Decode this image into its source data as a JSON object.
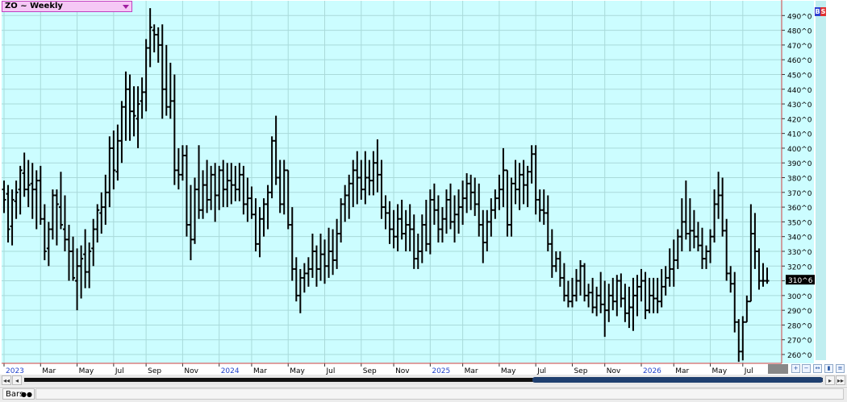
{
  "symbol_label": "ZO ~ Weekly",
  "bs_icons": {
    "buy": "B",
    "sell": "S"
  },
  "status": {
    "bars_label": "Bars"
  },
  "scroll": {
    "left_first": "◂◂",
    "left": "◂",
    "right": "▸",
    "right_last": "▸▸"
  },
  "toolbar_icons": [
    "zoom-in-icon",
    "zoom-out-icon",
    "scroll-icon",
    "chart-type-icon",
    "fit-icon",
    "settings-icon"
  ],
  "colors": {
    "background": "#ccfdff",
    "grid": "#a9dada",
    "bars": "#000000",
    "axis_line": "#d04040",
    "price_tag_bg": "#000000",
    "price_tag_text": "#ffffff",
    "month_text": "#000000",
    "year_text": "#2244cc"
  },
  "chart_data": {
    "type": "ohlc",
    "title": "ZO ~ Weekly",
    "ylim": [
      254,
      500
    ],
    "y_ticks": [
      260,
      270,
      280,
      290,
      300,
      310,
      320,
      330,
      340,
      350,
      360,
      370,
      380,
      390,
      400,
      410,
      420,
      430,
      440,
      450,
      460,
      470,
      480,
      490
    ],
    "y_tick_labels": [
      "260^0",
      "270^0",
      "280^0",
      "290^0",
      "300^0",
      "310^0",
      "320^0",
      "330^0",
      "340^0",
      "350^0",
      "360^0",
      "370^0",
      "380^0",
      "390^0",
      "400^0",
      "410^0",
      "420^0",
      "430^0",
      "440^0",
      "450^0",
      "460^0",
      "470^0",
      "480^0",
      "490^0"
    ],
    "last_price_label": "310^6",
    "last_price": 310.75,
    "x_labels": [
      {
        "label": "2023",
        "bar": 0,
        "year": true
      },
      {
        "label": "Mar",
        "bar": 9,
        "year": false
      },
      {
        "label": "May",
        "bar": 18,
        "year": false
      },
      {
        "label": "Jul",
        "bar": 27,
        "year": false
      },
      {
        "label": "Sep",
        "bar": 35,
        "year": false
      },
      {
        "label": "Nov",
        "bar": 44,
        "year": false
      },
      {
        "label": "2024",
        "bar": 53,
        "year": true
      },
      {
        "label": "Mar",
        "bar": 61,
        "year": false
      },
      {
        "label": "May",
        "bar": 70,
        "year": false
      },
      {
        "label": "Jul",
        "bar": 79,
        "year": false
      },
      {
        "label": "Sep",
        "bar": 88,
        "year": false
      },
      {
        "label": "Nov",
        "bar": 96,
        "year": false
      },
      {
        "label": "2025",
        "bar": 105,
        "year": true
      },
      {
        "label": "Mar",
        "bar": 113,
        "year": false
      },
      {
        "label": "May",
        "bar": 122,
        "year": false
      },
      {
        "label": "Jul",
        "bar": 131,
        "year": false
      },
      {
        "label": "Sep",
        "bar": 140,
        "year": false
      },
      {
        "label": "Nov",
        "bar": 148,
        "year": false
      },
      {
        "label": "2026",
        "bar": 157,
        "year": true
      },
      {
        "label": "Mar",
        "bar": 165,
        "year": false
      },
      {
        "label": "May",
        "bar": 174,
        "year": false
      },
      {
        "label": "Jul",
        "bar": 182,
        "year": false
      }
    ],
    "bars": [
      [
        372,
        378,
        356,
        365
      ],
      [
        369,
        375,
        336,
        345
      ],
      [
        347,
        372,
        334,
        365
      ],
      [
        364,
        378,
        352,
        370
      ],
      [
        372,
        388,
        355,
        385
      ],
      [
        383,
        397,
        367,
        372
      ],
      [
        372,
        392,
        360,
        375
      ],
      [
        376,
        390,
        352,
        372
      ],
      [
        372,
        385,
        345,
        378
      ],
      [
        378,
        388,
        348,
        352
      ],
      [
        352,
        362,
        324,
        330
      ],
      [
        332,
        350,
        320,
        345
      ],
      [
        345,
        372,
        338,
        368
      ],
      [
        368,
        372,
        334,
        362
      ],
      [
        360,
        384,
        345,
        348
      ],
      [
        345,
        368,
        330,
        338
      ],
      [
        338,
        348,
        310,
        330
      ],
      [
        330,
        340,
        310,
        312
      ],
      [
        310,
        332,
        290,
        320
      ],
      [
        320,
        334,
        298,
        325
      ],
      [
        328,
        345,
        305,
        316
      ],
      [
        316,
        336,
        305,
        330
      ],
      [
        332,
        352,
        320,
        345
      ],
      [
        345,
        362,
        336,
        358
      ],
      [
        356,
        370,
        342,
        360
      ],
      [
        360,
        382,
        348,
        370
      ],
      [
        370,
        408,
        360,
        400
      ],
      [
        400,
        412,
        372,
        385
      ],
      [
        384,
        416,
        378,
        405
      ],
      [
        405,
        432,
        390,
        428
      ],
      [
        428,
        452,
        405,
        440
      ],
      [
        440,
        450,
        405,
        425
      ],
      [
        425,
        442,
        408,
        422
      ],
      [
        420,
        442,
        400,
        430
      ],
      [
        432,
        448,
        420,
        438
      ],
      [
        438,
        474,
        425,
        468
      ],
      [
        468,
        495,
        455,
        482
      ],
      [
        480,
        484,
        465,
        477
      ],
      [
        477,
        482,
        458,
        470
      ],
      [
        470,
        484,
        420,
        440
      ],
      [
        440,
        470,
        422,
        428
      ],
      [
        428,
        458,
        420,
        432
      ],
      [
        432,
        450,
        375,
        385
      ],
      [
        385,
        400,
        372,
        382
      ],
      [
        382,
        402,
        378,
        395
      ],
      [
        395,
        402,
        340,
        348
      ],
      [
        348,
        375,
        324,
        338
      ],
      [
        338,
        380,
        335,
        372
      ],
      [
        372,
        402,
        352,
        358
      ],
      [
        358,
        385,
        352,
        375
      ],
      [
        375,
        392,
        356,
        365
      ],
      [
        365,
        388,
        358,
        382
      ],
      [
        382,
        390,
        350,
        368
      ],
      [
        368,
        388,
        358,
        385
      ],
      [
        385,
        392,
        360,
        372
      ],
      [
        372,
        390,
        360,
        378
      ],
      [
        378,
        390,
        362,
        375
      ],
      [
        375,
        388,
        364,
        372
      ],
      [
        372,
        390,
        364,
        382
      ],
      [
        382,
        388,
        355,
        362
      ],
      [
        362,
        380,
        350,
        366
      ],
      [
        366,
        374,
        352,
        355
      ],
      [
        355,
        366,
        330,
        335
      ],
      [
        335,
        360,
        326,
        352
      ],
      [
        352,
        366,
        340,
        362
      ],
      [
        362,
        375,
        345,
        370
      ],
      [
        370,
        408,
        366,
        405
      ],
      [
        405,
        422,
        375,
        380
      ],
      [
        380,
        392,
        356,
        362
      ],
      [
        362,
        392,
        355,
        385
      ],
      [
        385,
        382,
        345,
        348
      ],
      [
        348,
        360,
        310,
        318
      ],
      [
        318,
        326,
        296,
        300
      ],
      [
        300,
        318,
        288,
        312
      ],
      [
        312,
        322,
        302,
        315
      ],
      [
        315,
        326,
        306,
        318
      ],
      [
        318,
        342,
        312,
        330
      ],
      [
        330,
        334,
        306,
        318
      ],
      [
        318,
        342,
        310,
        328
      ],
      [
        328,
        338,
        308,
        320
      ],
      [
        320,
        346,
        312,
        330
      ],
      [
        330,
        345,
        314,
        324
      ],
      [
        324,
        352,
        318,
        342
      ],
      [
        342,
        366,
        336,
        362
      ],
      [
        362,
        375,
        350,
        368
      ],
      [
        368,
        382,
        352,
        376
      ],
      [
        376,
        392,
        360,
        385
      ],
      [
        385,
        398,
        362,
        380
      ],
      [
        380,
        392,
        365,
        372
      ],
      [
        372,
        398,
        362,
        380
      ],
      [
        380,
        392,
        368,
        378
      ],
      [
        378,
        398,
        368,
        390
      ],
      [
        390,
        406,
        370,
        382
      ],
      [
        382,
        392,
        352,
        360
      ],
      [
        360,
        368,
        345,
        356
      ],
      [
        356,
        364,
        335,
        345
      ],
      [
        345,
        358,
        332,
        340
      ],
      [
        340,
        362,
        330,
        352
      ],
      [
        352,
        365,
        338,
        342
      ],
      [
        342,
        358,
        330,
        348
      ],
      [
        348,
        362,
        330,
        345
      ],
      [
        345,
        355,
        318,
        325
      ],
      [
        325,
        342,
        318,
        330
      ],
      [
        330,
        355,
        322,
        348
      ],
      [
        348,
        365,
        330,
        335
      ],
      [
        335,
        372,
        328,
        365
      ],
      [
        365,
        376,
        348,
        358
      ],
      [
        358,
        368,
        336,
        345
      ],
      [
        345,
        360,
        336,
        352
      ],
      [
        352,
        372,
        342,
        365
      ],
      [
        365,
        376,
        345,
        350
      ],
      [
        350,
        368,
        336,
        355
      ],
      [
        355,
        372,
        342,
        360
      ],
      [
        360,
        378,
        348,
        366
      ],
      [
        366,
        383,
        356,
        376
      ],
      [
        376,
        382,
        358,
        370
      ],
      [
        370,
        380,
        354,
        362
      ],
      [
        362,
        376,
        340,
        348
      ],
      [
        348,
        358,
        322,
        336
      ],
      [
        336,
        358,
        330,
        350
      ],
      [
        350,
        366,
        340,
        358
      ],
      [
        358,
        372,
        352,
        366
      ],
      [
        366,
        382,
        358,
        372
      ],
      [
        372,
        400,
        360,
        385
      ],
      [
        385,
        384,
        340,
        348
      ],
      [
        348,
        380,
        340,
        376
      ],
      [
        376,
        392,
        362,
        372
      ],
      [
        372,
        390,
        358,
        382
      ],
      [
        382,
        392,
        362,
        375
      ],
      [
        375,
        388,
        360,
        384
      ],
      [
        384,
        402,
        376,
        396
      ],
      [
        396,
        402,
        355,
        365
      ],
      [
        365,
        372,
        350,
        358
      ],
      [
        358,
        372,
        348,
        356
      ],
      [
        356,
        368,
        330,
        335
      ],
      [
        335,
        345,
        312,
        320
      ],
      [
        320,
        330,
        316,
        325
      ],
      [
        325,
        330,
        306,
        312
      ],
      [
        312,
        322,
        296,
        300
      ],
      [
        300,
        310,
        292,
        296
      ],
      [
        296,
        312,
        292,
        300
      ],
      [
        300,
        318,
        296,
        310
      ],
      [
        310,
        324,
        300,
        320
      ],
      [
        320,
        322,
        296,
        300
      ],
      [
        300,
        308,
        292,
        302
      ],
      [
        302,
        312,
        288,
        292
      ],
      [
        292,
        306,
        286,
        300
      ],
      [
        300,
        316,
        288,
        294
      ],
      [
        294,
        310,
        272,
        290
      ],
      [
        290,
        308,
        282,
        300
      ],
      [
        300,
        312,
        290,
        296
      ],
      [
        296,
        314,
        286,
        310
      ],
      [
        310,
        315,
        292,
        298
      ],
      [
        298,
        308,
        282,
        288
      ],
      [
        288,
        306,
        278,
        292
      ],
      [
        292,
        312,
        276,
        300
      ],
      [
        300,
        314,
        286,
        306
      ],
      [
        306,
        318,
        296,
        310
      ],
      [
        310,
        316,
        284,
        290
      ],
      [
        290,
        312,
        288,
        300
      ],
      [
        300,
        312,
        288,
        298
      ],
      [
        298,
        312,
        288,
        296
      ],
      [
        296,
        318,
        292,
        306
      ],
      [
        306,
        320,
        300,
        312
      ],
      [
        312,
        332,
        306,
        318
      ],
      [
        318,
        338,
        306,
        324
      ],
      [
        324,
        345,
        318,
        340
      ],
      [
        340,
        366,
        330,
        350
      ],
      [
        350,
        378,
        338,
        342
      ],
      [
        342,
        366,
        330,
        344
      ],
      [
        344,
        358,
        332,
        340
      ],
      [
        340,
        350,
        330,
        334
      ],
      [
        334,
        346,
        318,
        325
      ],
      [
        325,
        334,
        318,
        330
      ],
      [
        330,
        345,
        322,
        340
      ],
      [
        340,
        372,
        336,
        362
      ],
      [
        362,
        384,
        352,
        368
      ],
      [
        368,
        380,
        340,
        344
      ],
      [
        344,
        352,
        310,
        315
      ],
      [
        315,
        320,
        302,
        308
      ],
      [
        308,
        316,
        275,
        282
      ],
      [
        282,
        284,
        255,
        262
      ],
      [
        262,
        286,
        256,
        282
      ],
      [
        282,
        300,
        288,
        296
      ],
      [
        296,
        362,
        298,
        342
      ],
      [
        342,
        356,
        318,
        330
      ],
      [
        330,
        332,
        304,
        310
      ],
      [
        310,
        322,
        306,
        310
      ],
      [
        310,
        319,
        308,
        310
      ]
    ]
  }
}
